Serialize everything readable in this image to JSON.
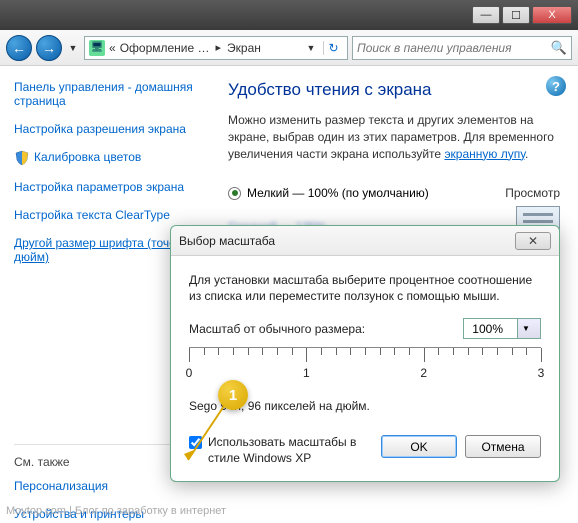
{
  "window": {
    "minimize": "—",
    "maximize": "☐",
    "close": "X"
  },
  "nav": {
    "back": "←",
    "forward": "→",
    "breadcrumb_prefix": "«",
    "breadcrumb1": "Оформление …",
    "breadcrumb2": "Экран",
    "search_placeholder": "Поиск в панели управления"
  },
  "sidebar": {
    "items": [
      "Панель управления - домашняя страница",
      "Настройка разрешения экрана",
      "Калибровка цветов",
      "Настройка параметров экрана",
      "Настройка текста ClearType",
      "Другой размер шрифта (точек на дюйм)"
    ],
    "see_also_head": "См. также",
    "see_also": [
      "Персонализация",
      "Устройства и принтеры"
    ]
  },
  "main": {
    "heading": "Удобство чтения с экрана",
    "desc1": "Можно изменить размер текста и других элементов на экране, выбрав один из этих параметров. Для временного увеличения части экрана используйте ",
    "desc_link": "экранную лупу",
    "desc_tail": ".",
    "radio_small": "Мелкий — 100% (по умолчанию)",
    "preview_label": "Просмотр"
  },
  "dialog": {
    "title": "Выбор масштаба",
    "intro": "Для установки масштаба выберите процентное соотношение из списка или переместите ползунок с помощью мыши.",
    "scale_label": "Масштаб от обычного размера:",
    "scale_value": "100%",
    "ruler_numbers": [
      "0",
      "1",
      "2",
      "3"
    ],
    "sample": "Sego          9 пт, 96 пикселей на дюйм.",
    "checkbox_label": "Использовать масштабы в стиле Windows XP",
    "ok": "OK",
    "cancel": "Отмена"
  },
  "callout": {
    "num": "1"
  },
  "footer": "Moytop.com | Блог по заработку в интернет"
}
